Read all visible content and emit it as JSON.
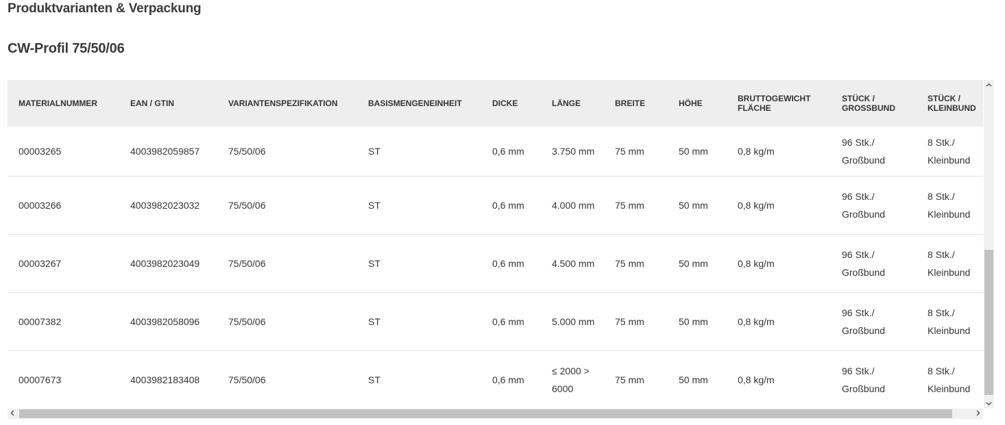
{
  "section_title": "Produktvarianten & Verpackung",
  "product_title": "CW-Profil 75/50/06",
  "table": {
    "headers": [
      "MATERIALNUMMER",
      "EAN / GTIN",
      "VARIANTENSPEZIFIKATION",
      "BASISMENGENEINHEIT",
      "DICKE",
      "LÄNGE",
      "BREITE",
      "HÖHE",
      "BRUTTOGEWICHT FLÄCHE",
      "STÜCK / GROSSBUND",
      "STÜCK / KLEINBUND"
    ],
    "rows": [
      [
        "00003265",
        "4003982059857",
        "75/50/06",
        "ST",
        "0,6 mm",
        "3.750 mm",
        "75 mm",
        "50 mm",
        "0,8 kg/m",
        "96 Stk./ Großbund",
        "8 Stk./ Kleinbund"
      ],
      [
        "00003266",
        "4003982023032",
        "75/50/06",
        "ST",
        "0,6 mm",
        "4.000 mm",
        "75 mm",
        "50 mm",
        "0,8 kg/m",
        "96 Stk./ Großbund",
        "8 Stk./ Kleinbund"
      ],
      [
        "00003267",
        "4003982023049",
        "75/50/06",
        "ST",
        "0,6 mm",
        "4.500 mm",
        "75 mm",
        "50 mm",
        "0,8 kg/m",
        "96 Stk./ Großbund",
        "8 Stk./ Kleinbund"
      ],
      [
        "00007382",
        "4003982058096",
        "75/50/06",
        "ST",
        "0,6 mm",
        "5.000 mm",
        "75 mm",
        "50 mm",
        "0,8 kg/m",
        "96 Stk./ Großbund",
        "8 Stk./ Kleinbund"
      ],
      [
        "00007673",
        "4003982183408",
        "75/50/06",
        "ST",
        "0,6 mm",
        "≤ 2000 > 6000",
        "75 mm",
        "50 mm",
        "0,8 kg/m",
        "96 Stk./ Großbund",
        "8 Stk./ Kleinbund"
      ]
    ]
  },
  "scrollbars": {
    "up_icon": "chevron-up-icon",
    "down_icon": "chevron-down-icon",
    "left_icon": "chevron-left-icon",
    "right_icon": "chevron-right-icon"
  }
}
